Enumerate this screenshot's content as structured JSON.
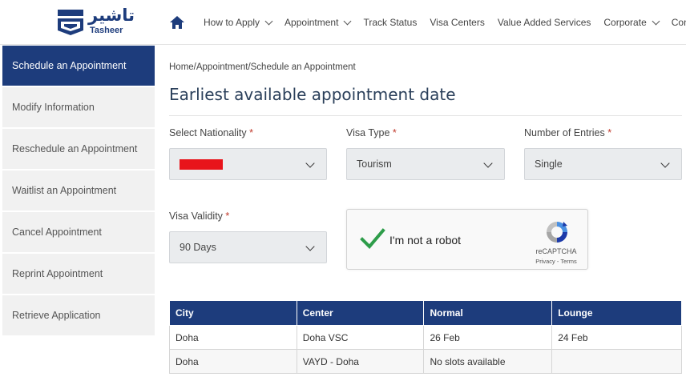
{
  "logo": {
    "arabic": "تاشير",
    "english": "Tasheer"
  },
  "nav": {
    "items": [
      {
        "label": "How to Apply",
        "dropdown": true
      },
      {
        "label": "Appointment",
        "dropdown": true
      },
      {
        "label": "Track Status",
        "dropdown": false
      },
      {
        "label": "Visa Centers",
        "dropdown": false
      },
      {
        "label": "Value Added Services",
        "dropdown": false
      },
      {
        "label": "Corporate",
        "dropdown": true
      },
      {
        "label": "Contact",
        "dropdown": false
      }
    ]
  },
  "sidebar": {
    "items": [
      {
        "label": "Schedule an Appointment",
        "active": true
      },
      {
        "label": "Modify Information"
      },
      {
        "label": "Reschedule an Appointment"
      },
      {
        "label": "Waitlist an Appointment"
      },
      {
        "label": "Cancel Appointment"
      },
      {
        "label": "Reprint Appointment"
      },
      {
        "label": "Retrieve Application"
      }
    ]
  },
  "breadcrumb": "Home/Appointment/Schedule an Appointment",
  "page_title": "Earliest available appointment date",
  "form": {
    "nationality": {
      "label": "Select Nationality",
      "required_mark": "*"
    },
    "visa_type": {
      "label": "Visa Type",
      "required_mark": "*",
      "value": "Tourism"
    },
    "entries": {
      "label": "Number of Entries",
      "required_mark": "*",
      "value": "Single"
    },
    "validity": {
      "label": "Visa Validity",
      "required_mark": "*",
      "value": "90 Days"
    }
  },
  "captcha": {
    "label": "I'm not a robot",
    "brand": "reCAPTCHA",
    "links": "Privacy - Terms"
  },
  "table": {
    "headers": [
      "City",
      "Center",
      "Normal",
      "Lounge"
    ],
    "rows": [
      {
        "city": "Doha",
        "center": "Doha VSC",
        "normal": "26 Feb",
        "lounge": "24 Feb"
      },
      {
        "city": "Doha",
        "center": "VAYD - Doha",
        "normal": "No slots available",
        "lounge": ""
      }
    ]
  },
  "colors": {
    "brand_blue": "#1d3c7c",
    "required_red": "#c0392b",
    "redaction": "#e8141b",
    "check_green": "#2e9d4a"
  }
}
